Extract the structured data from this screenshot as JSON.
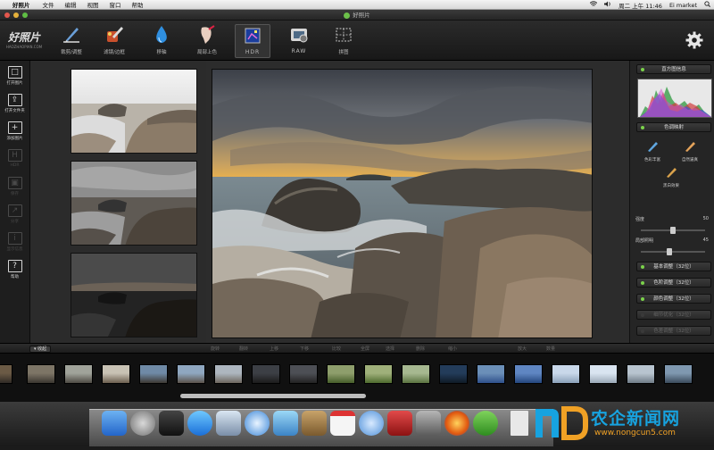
{
  "menubar": {
    "app": "好照片",
    "items": [
      "文件",
      "编辑",
      "视图",
      "窗口",
      "帮助"
    ],
    "clock": "周二 上午 11:46",
    "user": "Ei market"
  },
  "window": {
    "title": "好照片"
  },
  "logo": {
    "title": "好照片",
    "subtitle": "HAOZHAOPIAN.COM"
  },
  "toolbar": {
    "tools": [
      {
        "label": "裁剪/调整",
        "icon": "crop-pen-icon"
      },
      {
        "label": "滤镜/边框",
        "icon": "filter-brush-icon"
      },
      {
        "label": "移轴",
        "icon": "tilt-shift-drop-icon"
      },
      {
        "label": "局部上色",
        "icon": "local-color-icon"
      },
      {
        "label": "HDR",
        "icon": "hdr-icon"
      },
      {
        "label": "RAW",
        "icon": "raw-icon"
      },
      {
        "label": "拼图",
        "icon": "collage-icon"
      }
    ],
    "settings_icon": "gear-icon"
  },
  "sidebar": {
    "items": [
      {
        "label": "打开图片",
        "enabled": true,
        "glyph": "□"
      },
      {
        "label": "打开文件夹",
        "enabled": true,
        "glyph": "⇪"
      },
      {
        "label": "添加图片",
        "enabled": true,
        "glyph": "+"
      },
      {
        "label": "HDR",
        "enabled": false,
        "glyph": "H"
      },
      {
        "label": "保存",
        "enabled": false,
        "glyph": "▣"
      },
      {
        "label": "分享",
        "enabled": false,
        "glyph": "↗"
      },
      {
        "label": "显示信息",
        "enabled": false,
        "glyph": "i"
      },
      {
        "label": "帮助",
        "enabled": true,
        "glyph": "?"
      }
    ]
  },
  "right_panel": {
    "histogram_label": "直方图信息",
    "tone_mapping_label": "色调映射",
    "presets": [
      "色彩丰富",
      "自然逼真",
      "黑白效果"
    ],
    "sliders": [
      {
        "label": "强度",
        "value": "50",
        "level": 0.5
      },
      {
        "label": "局部照明",
        "value": "45",
        "level": 0.45
      }
    ],
    "sections": [
      {
        "label": "基本调整（32位）",
        "enabled": true
      },
      {
        "label": "色阶调整（32位）",
        "enabled": true
      },
      {
        "label": "颜色调整（32位）",
        "enabled": true
      },
      {
        "label": "细节优化（32位）",
        "enabled": false
      },
      {
        "label": "色差调整（32位）",
        "enabled": false
      }
    ]
  },
  "filmstrip": {
    "collapse_label": "收起",
    "toolbar_items": [
      "旋转",
      "翻转",
      "上移",
      "下移",
      "比较",
      "全屏",
      "选择",
      "删除",
      "缩小",
      "放大",
      "数量"
    ],
    "thumb_count": 19
  },
  "watermark": {
    "title": "农企新闻网",
    "url": "www.nongcun5.com"
  },
  "colors": {
    "accent": "#7bd24b",
    "panel": "#252525",
    "toolbar": "#1d1d1d"
  }
}
